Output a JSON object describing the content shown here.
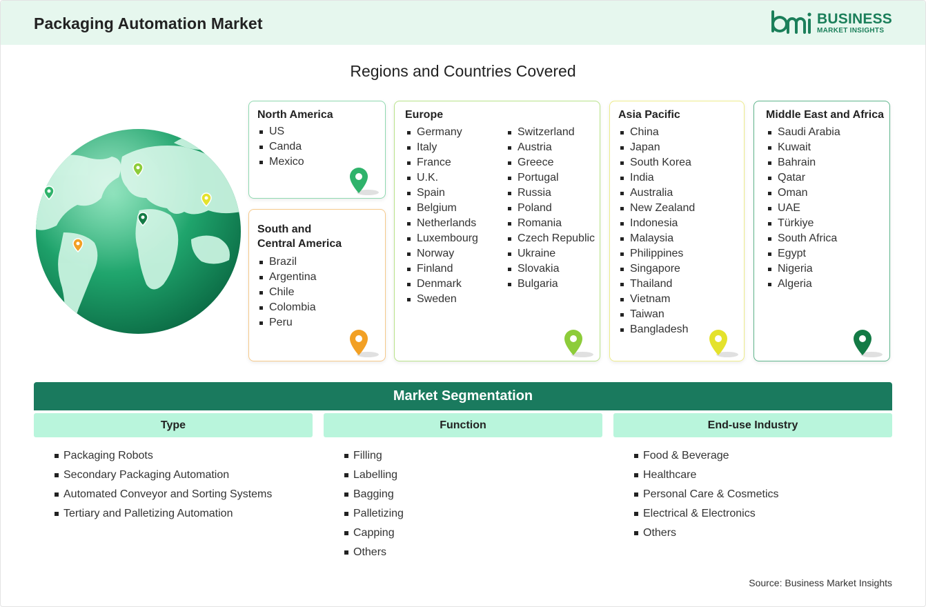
{
  "header": {
    "title": "Packaging Automation Market"
  },
  "logo": {
    "line1": "BUSINESS",
    "line2": "MARKET INSIGHTS",
    "color": "#1b7f5a"
  },
  "regions_title": "Regions and Countries Covered",
  "regions": {
    "north_america": {
      "title": "North America",
      "items": [
        "US",
        "Canda",
        "Mexico"
      ],
      "pin_color": "#2fb36b"
    },
    "south_america": {
      "title_line1": "South and",
      "title_line2": "Central America",
      "items": [
        "Brazil",
        "Argentina",
        "Chile",
        "Colombia",
        "Peru"
      ],
      "pin_color": "#f2a024"
    },
    "europe": {
      "title": "Europe",
      "col1": [
        "Germany",
        "Italy",
        "France",
        "U.K.",
        "Spain",
        "Belgium",
        "Netherlands",
        "Luxembourg",
        "Norway",
        "Finland",
        "Denmark",
        "Sweden"
      ],
      "col2": [
        "Switzerland",
        "Austria",
        "Greece",
        "Portugal",
        "Russia",
        "Poland",
        "Romania",
        "Czech Republic",
        "Ukraine",
        "Slovakia",
        "Bulgaria"
      ],
      "pin_color": "#8dcc3a"
    },
    "asia_pacific": {
      "title": "Asia Pacific",
      "items": [
        "China",
        "Japan",
        "South Korea",
        "India",
        "Australia",
        "New Zealand",
        "Indonesia",
        "Malaysia",
        "Philippines",
        "Singapore",
        "Thailand",
        "Vietnam",
        "Taiwan",
        "Bangladesh"
      ],
      "pin_color": "#e4e22c"
    },
    "middle_east_africa": {
      "title": "Middle East and Africa",
      "items": [
        "Saudi Arabia",
        "Kuwait",
        "Bahrain",
        "Qatar",
        "Oman",
        "UAE",
        "Türkiye",
        "South Africa",
        "Egypt",
        "Nigeria",
        "Algeria"
      ],
      "pin_color": "#137a45"
    }
  },
  "segmentation": {
    "title": "Market Segmentation",
    "columns": [
      {
        "header": "Type",
        "items": [
          "Packaging Robots",
          "Secondary Packaging Automation",
          "Automated Conveyor and Sorting Systems",
          "Tertiary and Palletizing Automation"
        ]
      },
      {
        "header": "Function",
        "items": [
          "Filling",
          "Labelling",
          "Bagging",
          "Palletizing",
          "Capping",
          "Others"
        ]
      },
      {
        "header": "End-use Industry",
        "items": [
          "Food & Beverage",
          "Healthcare",
          "Personal Care & Cosmetics",
          "Electrical & Electronics",
          "Others"
        ]
      }
    ]
  },
  "source": "Source: Business Market Insights",
  "colors": {
    "accent": "#1a7a5e",
    "header_bg": "#e6f7ee",
    "seg_header_bg": "#b9f5dc"
  }
}
